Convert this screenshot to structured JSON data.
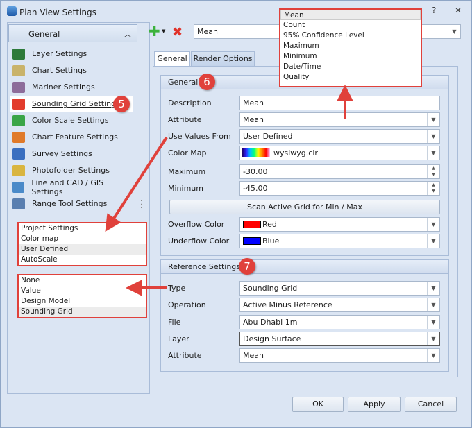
{
  "window": {
    "title": "Plan View Settings",
    "help": "?",
    "close": "✕"
  },
  "sidebar": {
    "header": "General",
    "items": [
      {
        "label": "Layer Settings",
        "color": "#2d7a3a"
      },
      {
        "label": "Chart Settings",
        "color": "#c9b36a"
      },
      {
        "label": "Mariner Settings",
        "color": "#8d6c9a"
      },
      {
        "label": "Sounding Grid Settings",
        "color": "#e23c2c"
      },
      {
        "label": "Color Scale Settings",
        "color": "#3aa547"
      },
      {
        "label": "Chart Feature Settings",
        "color": "#e07a2a"
      },
      {
        "label": "Survey Settings",
        "color": "#3a6fc0"
      },
      {
        "label": "Photofolder Settings",
        "color": "#d9b540"
      },
      {
        "label": "Line and CAD / GIS Settings",
        "color": "#4a8ac9"
      },
      {
        "label": "Range Tool Settings",
        "color": "#5a7fb0"
      }
    ],
    "selected_badge": "5"
  },
  "callouts": {
    "use_values_options": [
      "Project Settings",
      "Color map",
      "User Defined",
      "AutoScale"
    ],
    "type_options": [
      "None",
      "Value",
      "Design Model",
      "Sounding Grid"
    ],
    "attribute_options": [
      "Mean",
      "Count",
      "95% Confidence Level",
      "Maximum",
      "Minimum",
      "Date/Time",
      "Quality"
    ]
  },
  "toolbar": {
    "combo_value": "Mean"
  },
  "tabs": [
    "General",
    "Render Options"
  ],
  "general": {
    "title": "General",
    "badge": "6",
    "description_label": "Description",
    "description": "Mean",
    "attribute_label": "Attribute",
    "attribute": "Mean",
    "use_values_label": "Use Values From",
    "use_values": "User Defined",
    "color_map_label": "Color Map",
    "color_map": "wysiwyg.clr",
    "maximum_label": "Maximum",
    "maximum": "-30.00",
    "minimum_label": "Minimum",
    "minimum": "-45.00",
    "scan_button": "Scan Active Grid for Min / Max",
    "overflow_label": "Overflow Color",
    "overflow": "Red",
    "overflow_color": "#ff0000",
    "underflow_label": "Underflow Color",
    "underflow": "Blue",
    "underflow_color": "#0000ff"
  },
  "reference": {
    "title": "Reference Settings",
    "badge": "7",
    "type_label": "Type",
    "type": "Sounding Grid",
    "operation_label": "Operation",
    "operation": "Active Minus Reference",
    "file_label": "File",
    "file": "Abu Dhabi 1m",
    "layer_label": "Layer",
    "layer": "Design Surface",
    "attribute_label": "Attribute",
    "attribute": "Mean"
  },
  "footer": {
    "ok": "OK",
    "apply": "Apply",
    "cancel": "Cancel"
  }
}
